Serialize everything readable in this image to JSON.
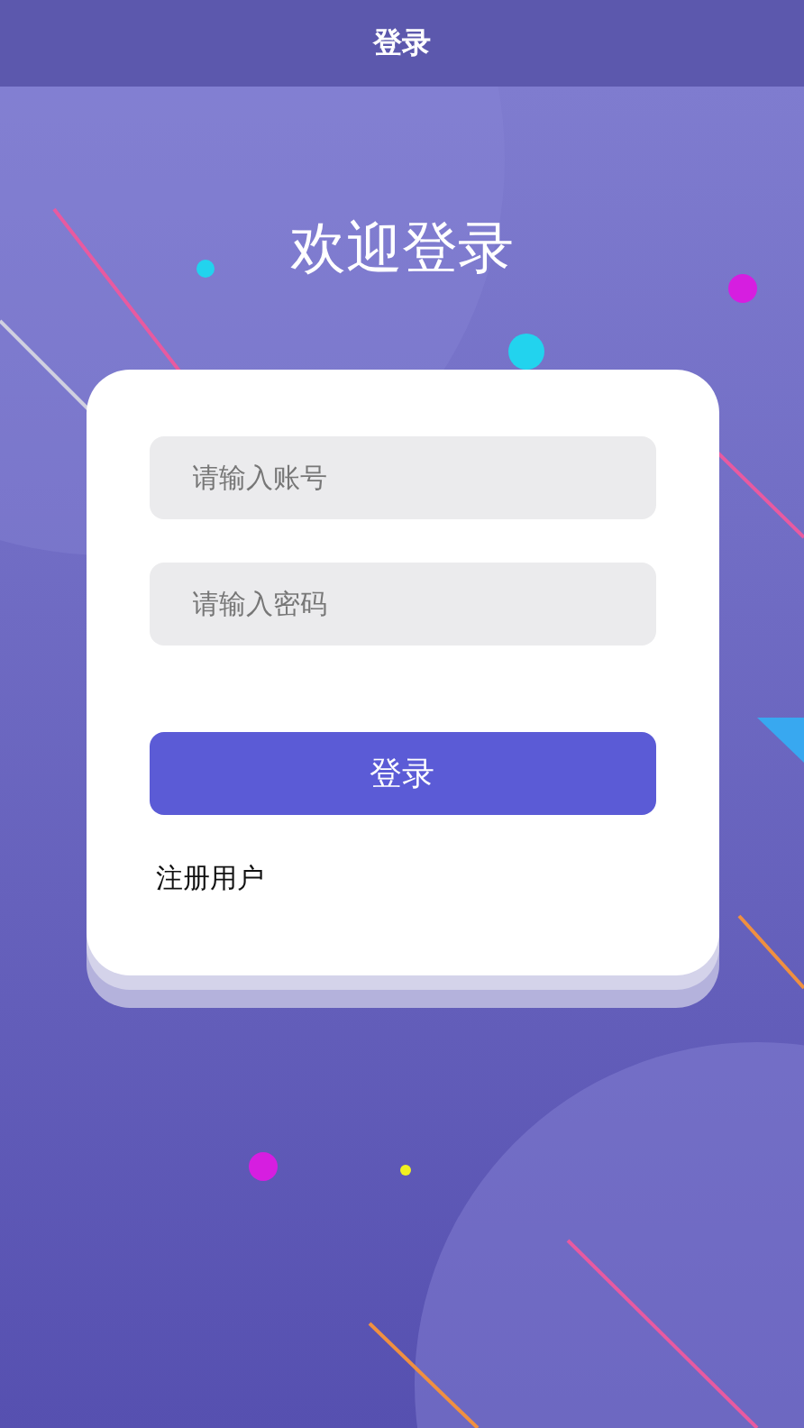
{
  "header": {
    "title": "登录"
  },
  "heading": "欢迎登录",
  "form": {
    "fields": [
      {
        "placeholder": "请输入账号"
      },
      {
        "placeholder": "请输入密码"
      }
    ],
    "submit": "登录",
    "register_link": "注册用户"
  }
}
